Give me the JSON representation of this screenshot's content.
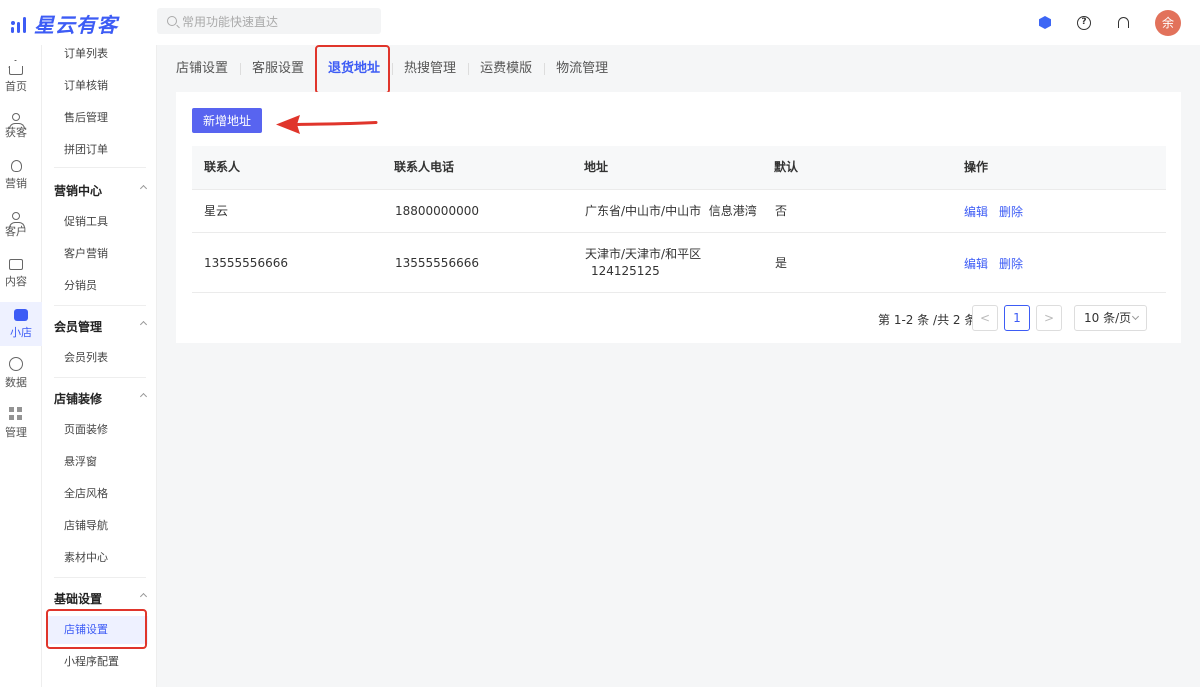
{
  "app": {
    "logo_text": "星云有客"
  },
  "search": {
    "placeholder": "常用功能快速直达"
  },
  "header": {
    "avatar_text": "余"
  },
  "rail": [
    {
      "label": "首页",
      "icon": "home-icon"
    },
    {
      "label": "获客",
      "icon": "user-plus-icon"
    },
    {
      "label": "营销",
      "icon": "bulb-icon"
    },
    {
      "label": "客户",
      "icon": "user-icon"
    },
    {
      "label": "内容",
      "icon": "folder-icon"
    },
    {
      "label": "小店",
      "icon": "shop-icon",
      "active": true
    },
    {
      "label": "数据",
      "icon": "pie-chart-icon"
    },
    {
      "label": "管理",
      "icon": "grid-icon"
    }
  ],
  "subnav": {
    "order_items": [
      "订单列表",
      "订单核销",
      "售后管理",
      "拼团订单"
    ],
    "marketing_title": "营销中心",
    "marketing_items": [
      "促销工具",
      "客户营销",
      "分销员"
    ],
    "member_title": "会员管理",
    "member_items": [
      "会员列表"
    ],
    "decor_title": "店铺装修",
    "decor_items": [
      "页面装修",
      "悬浮窗",
      "全店风格",
      "店铺导航",
      "素材中心"
    ],
    "basic_title": "基础设置",
    "basic_items": [
      "店铺设置",
      "小程序配置"
    ]
  },
  "tabs": [
    "店铺设置",
    "客服设置",
    "退货地址",
    "热搜管理",
    "运费模版",
    "物流管理"
  ],
  "actions": {
    "add_label": "新增地址"
  },
  "table": {
    "headers": [
      "联系人",
      "联系人电话",
      "地址",
      "默认",
      "操作"
    ],
    "rows": [
      {
        "name": "星云",
        "phone": "18800000000",
        "address": "广东省/中山市/中山市  信息港湾",
        "address2": "",
        "default": "否",
        "edit": "编辑",
        "delete": "删除"
      },
      {
        "name": "13555556666",
        "phone": "13555556666",
        "address": "天津市/天津市/和平区",
        "address2": "124125125",
        "default": "是",
        "edit": "编辑",
        "delete": "删除"
      }
    ]
  },
  "pagination": {
    "summary": "第 1-2 条 /共 2 条",
    "prev": "<",
    "current": "1",
    "next": ">",
    "page_size": "10 条/页"
  },
  "colors": {
    "accent": "#3d5cf5",
    "highlight": "#e0352b",
    "button": "#5864f0"
  }
}
